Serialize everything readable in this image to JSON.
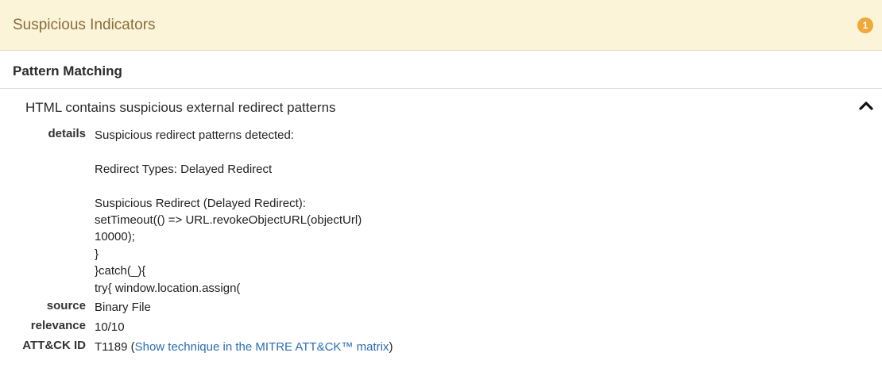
{
  "header": {
    "title": "Suspicious Indicators",
    "count": "1",
    "badge_color": "#f0a93b"
  },
  "section": {
    "title": "Pattern Matching"
  },
  "indicator": {
    "title": "HTML contains suspicious external redirect patterns",
    "collapse_icon": "chevron-up-icon",
    "fields": {
      "details_label": "details",
      "details_value": "Suspicious redirect patterns detected:\n\nRedirect Types: Delayed Redirect\n\nSuspicious Redirect (Delayed Redirect):\nsetTimeout(() => URL.revokeObjectURL(objectUrl)\n10000);\n}\n}catch(_){\ntry{ window.location.assign(",
      "source_label": "source",
      "source_value": "Binary File",
      "relevance_label": "relevance",
      "relevance_value": "10/10",
      "attack_label": "ATT&CK ID",
      "attack_id": "T1189",
      "attack_open": " (",
      "attack_link": "Show technique in the MITRE ATT&CK™ matrix",
      "attack_close": ")"
    }
  }
}
